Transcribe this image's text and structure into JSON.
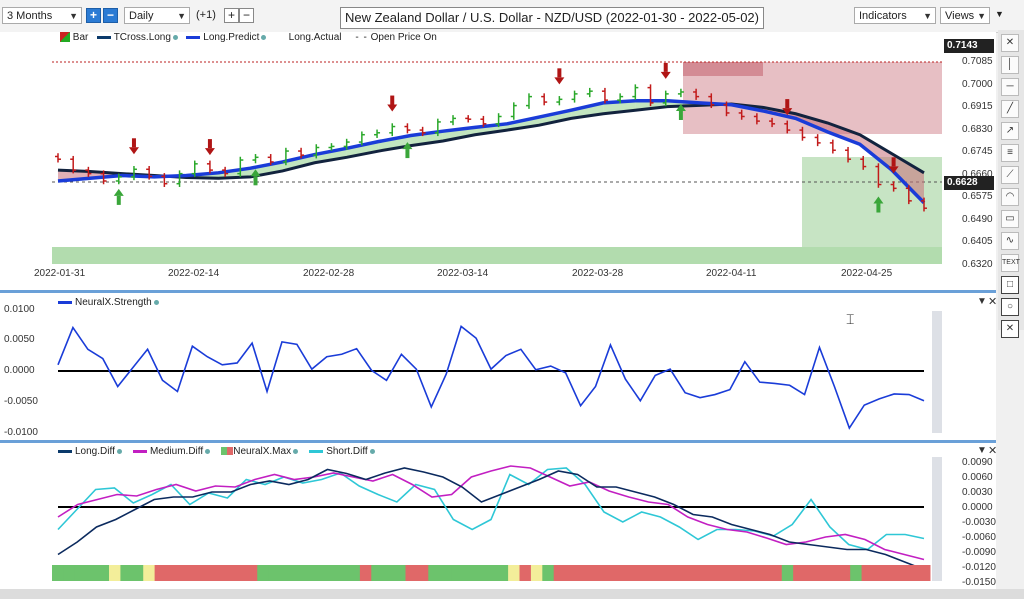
{
  "toolbar": {
    "range_label": "3 Months",
    "interval_label": "Daily",
    "offset_label": "(+1)",
    "title": "New Zealand Dollar / U.S. Dollar - NZD/USD (2022-01-30 - 2022-05-02)",
    "indicators_label": "Indicators",
    "views_label": "Views"
  },
  "price_pane": {
    "legend": [
      "Bar",
      "TCross.Long",
      "Long.Predict",
      "Long.Actual",
      "Open Price On"
    ],
    "y_ticks": [
      "0.7085",
      "0.7000",
      "0.6915",
      "0.6830",
      "0.6745",
      "0.6660",
      "0.6575",
      "0.6490",
      "0.6405",
      "0.6320"
    ],
    "x_dates": [
      "2022-01-31",
      "2022-02-14",
      "2022-02-28",
      "2022-03-14",
      "2022-03-28",
      "2022-04-11",
      "2022-04-25"
    ],
    "top_price": "0.7143",
    "current_price": "0.6628"
  },
  "strength_pane": {
    "legend": "NeuralX.Strength",
    "y_ticks": [
      "0.0100",
      "0.0050",
      "0.0000",
      "-0.0050",
      "-0.0100"
    ]
  },
  "diff_pane": {
    "legend": [
      "Long.Diff",
      "Medium.Diff",
      "NeuralX.Max",
      "Short.Diff"
    ],
    "y_ticks": [
      "0.0090",
      "0.0060",
      "0.0030",
      "0.0000",
      "-0.0030",
      "-0.0060",
      "-0.0090",
      "-0.0120",
      "-0.0150"
    ]
  },
  "chart_data": {
    "type": "line",
    "strength_values": [
      0.001,
      0.007,
      0.0035,
      0.002,
      -0.0025,
      0.0005,
      0.0035,
      -0.0015,
      -0.0033,
      0.004,
      0.0023,
      0.001,
      0.0013,
      0.0045,
      -0.0033,
      0.0047,
      0.0043,
      0.0003,
      0.0023,
      0.0027,
      0.0036,
      0.0001,
      -0.0015,
      0.0027,
      0.0003,
      -0.0058,
      -0.0005,
      0.0072,
      0.0053,
      0.0003,
      0.0025,
      0.0035,
      0.0002,
      0.0008,
      -0.0003,
      -0.0056,
      -0.0025,
      0.0042,
      -0.0013,
      -0.0048,
      -0.0007,
      0.0003,
      -0.0035,
      -0.0043,
      -0.0038,
      -0.003,
      0.0015,
      -0.0018,
      -0.002,
      -0.0023,
      -0.0038,
      0.0038,
      -0.0025,
      -0.0092,
      -0.0055,
      -0.0045,
      -0.0037,
      -0.0038,
      -0.0048
    ],
    "long_diff": [
      -0.0095,
      -0.007,
      -0.004,
      -0.0025,
      -0.0005,
      0.0015,
      0.002,
      0.002,
      0.003,
      0.003,
      0.0045,
      0.0052,
      0.0045,
      0.0055,
      0.0075,
      0.0067,
      0.0055,
      0.0068,
      0.0078,
      0.007,
      0.006,
      0.004,
      0.001,
      0.0025,
      0.004,
      0.0055,
      0.0072,
      0.0065,
      0.004,
      0.004,
      0.003,
      0.002,
      0.0005,
      -0.0015,
      -0.002,
      -0.0035,
      -0.0045,
      -0.0055,
      -0.007,
      -0.0075,
      -0.008,
      -0.0085,
      -0.0085,
      -0.0095,
      -0.011,
      -0.0125
    ],
    "medium_diff": [
      -0.002,
      0.0005,
      0.0015,
      0.0025,
      0.0022,
      0.0035,
      0.0045,
      0.0032,
      0.0042,
      0.004,
      0.0055,
      0.0065,
      0.0055,
      0.006,
      0.0068,
      0.006,
      0.0052,
      0.0065,
      0.0045,
      0.002,
      0.0025,
      0.006,
      0.0072,
      0.0082,
      0.0078,
      0.006,
      0.0042,
      0.005,
      0.0032,
      0.002,
      0.001,
      0.0005,
      -0.002,
      -0.0035,
      -0.0045,
      -0.005,
      -0.0062,
      -0.0075,
      -0.007,
      -0.006,
      -0.0055,
      -0.0065,
      -0.0085,
      -0.0095,
      -0.0105
    ],
    "short_diff": [
      -0.0045,
      -0.0005,
      0.0035,
      0.0038,
      0.0008,
      0.0025,
      0.0045,
      0.0005,
      0.0028,
      0.0018,
      0.0055,
      0.0045,
      0.006,
      0.0048,
      0.0055,
      0.0068,
      0.0042,
      0.0025,
      0.001,
      0.0045,
      0.0035,
      -0.0025,
      -0.0045,
      -0.0025,
      0.0065,
      0.0045,
      0.0075,
      0.0078,
      0.0045,
      -0.001,
      -0.003,
      -0.001,
      -0.002,
      -0.004,
      -0.0065,
      -0.0045,
      -0.0045,
      -0.0048,
      -0.0058,
      -0.0035,
      0.0015,
      -0.004,
      -0.0075,
      -0.0085,
      -0.0055,
      -0.0055,
      -0.0063
    ],
    "neuralx_max_colors": [
      "#6cc36c",
      "#6cc36c",
      "#6cc36c",
      "#6cc36c",
      "#6cc36c",
      "#f3ee9a",
      "#6cc36c",
      "#6cc36c",
      "#f3ee9a",
      "#e06868",
      "#e06868",
      "#e06868",
      "#e06868",
      "#e06868",
      "#e06868",
      "#e06868",
      "#e06868",
      "#e06868",
      "#6cc36c",
      "#6cc36c",
      "#6cc36c",
      "#6cc36c",
      "#6cc36c",
      "#6cc36c",
      "#6cc36c",
      "#6cc36c",
      "#6cc36c",
      "#e06868",
      "#6cc36c",
      "#6cc36c",
      "#6cc36c",
      "#e06868",
      "#e06868",
      "#6cc36c",
      "#6cc36c",
      "#6cc36c",
      "#6cc36c",
      "#6cc36c",
      "#6cc36c",
      "#6cc36c",
      "#f3ee9a",
      "#e06868",
      "#f3ee9a",
      "#6cc36c",
      "#e06868",
      "#e06868",
      "#e06868",
      "#e06868",
      "#e06868",
      "#e06868",
      "#e06868",
      "#e06868",
      "#e06868",
      "#e06868",
      "#e06868",
      "#e06868",
      "#e06868",
      "#e06868",
      "#e06868",
      "#e06868",
      "#e06868",
      "#e06868",
      "#e06868",
      "#e06868",
      "#6cc36c",
      "#e06868",
      "#e06868",
      "#e06868",
      "#e06868",
      "#e06868",
      "#6cc36c",
      "#e06868",
      "#e06868",
      "#e06868",
      "#e06868",
      "#e06868",
      "#e06868"
    ],
    "tcross_long": [
      0.6665,
      0.666,
      0.6652,
      0.6645,
      0.6638,
      0.6635,
      0.664,
      0.6662,
      0.6692,
      0.6712,
      0.6735,
      0.6755,
      0.6772,
      0.6795,
      0.6812,
      0.683,
      0.6855,
      0.6872,
      0.6885,
      0.6898,
      0.6903,
      0.6908,
      0.6895,
      0.6872,
      0.6838,
      0.6795,
      0.6725,
      0.6655
    ],
    "long_predict": [
      0.6625,
      0.6635,
      0.6645,
      0.664,
      0.6645,
      0.6655,
      0.6672,
      0.6695,
      0.6722,
      0.6745,
      0.677,
      0.6792,
      0.6808,
      0.6822,
      0.6835,
      0.686,
      0.6885,
      0.6912,
      0.692,
      0.692,
      0.6912,
      0.6905,
      0.6882,
      0.6855,
      0.6805,
      0.676,
      0.6665,
      0.6545
    ],
    "price_closes": [
      0.6705,
      0.6665,
      0.6652,
      0.6625,
      0.664,
      0.6668,
      0.6642,
      0.6615,
      0.6652,
      0.6688,
      0.6665,
      0.6652,
      0.6702,
      0.6712,
      0.6695,
      0.6735,
      0.672,
      0.6748,
      0.6752,
      0.6768,
      0.6795,
      0.6802,
      0.6825,
      0.6812,
      0.6802,
      0.6842,
      0.6855,
      0.6852,
      0.6835,
      0.6862,
      0.6902,
      0.6935,
      0.6915,
      0.6925,
      0.6945,
      0.6955,
      0.6922,
      0.6935,
      0.6968,
      0.6912,
      0.6945,
      0.6952,
      0.6935,
      0.6905,
      0.6875,
      0.6862,
      0.6845,
      0.6835,
      0.6812,
      0.6785,
      0.6765,
      0.6738,
      0.6705,
      0.6678,
      0.6612,
      0.6598,
      0.6552,
      0.6525
    ]
  }
}
